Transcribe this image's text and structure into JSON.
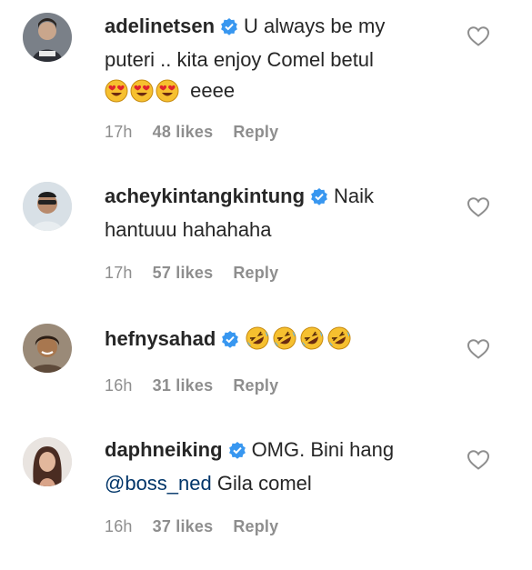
{
  "comments": [
    {
      "username": "adelinetsen",
      "text": "U always be my puteri .. kita enjoy Comel betul",
      "text_after_emoji": "eeee",
      "emoji": [
        "heart-eyes",
        "heart-eyes",
        "heart-eyes"
      ],
      "time": "17h",
      "likes": "48 likes",
      "reply": "Reply"
    },
    {
      "username": "acheykintangkintung",
      "text": "Naik hantuuu hahahaha",
      "time": "17h",
      "likes": "57 likes",
      "reply": "Reply"
    },
    {
      "username": "hefnysahad",
      "emoji": [
        "rolling-laughing",
        "rolling-laughing",
        "rolling-laughing",
        "rolling-laughing"
      ],
      "time": "16h",
      "likes": "31 likes",
      "reply": "Reply"
    },
    {
      "username": "daphneiking",
      "text": "OMG. Bini hang",
      "mention": "@boss_ned",
      "text_after_mention": "Gila comel",
      "time": "16h",
      "likes": "37 likes",
      "reply": "Reply"
    }
  ],
  "colors": {
    "verified": "#3897f0",
    "meta_text": "#8e8e8e",
    "mention": "#003569",
    "heart_outline": "#8e8e8e"
  },
  "icons": {
    "verified": "verified-badge-icon",
    "like": "heart-outline-icon"
  }
}
